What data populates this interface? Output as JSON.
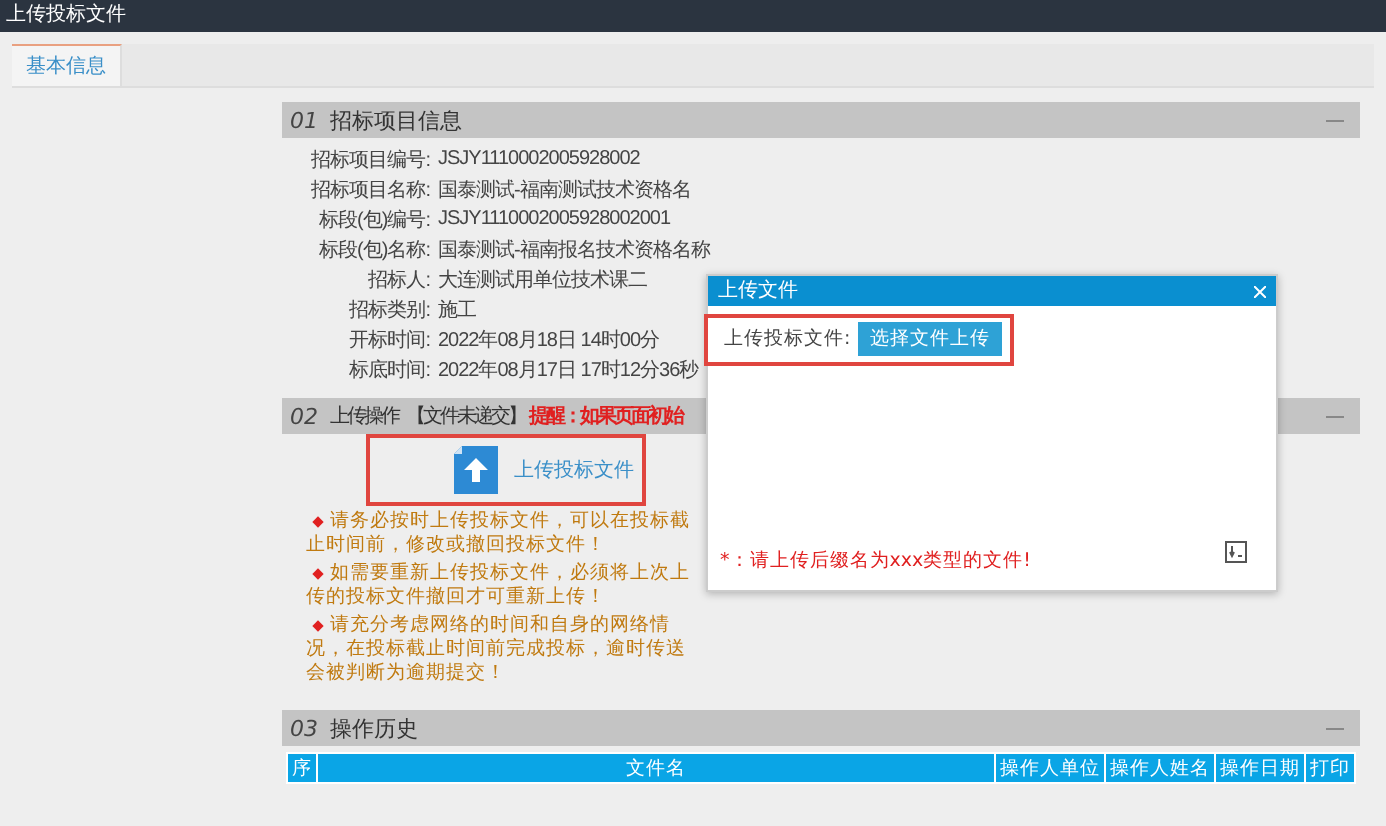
{
  "window": {
    "title": "上传投标文件"
  },
  "tabs": [
    {
      "label": "基本信息",
      "selected": true
    }
  ],
  "project_info": {
    "number": "01",
    "title": "招标项目信息",
    "fields": [
      {
        "label": "招标项目编号:",
        "value": "JSJY1110002005928002"
      },
      {
        "label": "招标项目名称:",
        "value": "国泰测试-福南测试技术资格名"
      },
      {
        "label": "标段(包)编号:",
        "value": "JSJY1110002005928002001"
      },
      {
        "label": "标段(包)名称:",
        "value": "国泰测试-福南报名技术资格名称"
      },
      {
        "label": "招标人:",
        "value": "大连测试用单位技术课二"
      },
      {
        "label": "招标类别:",
        "value": "施工"
      },
      {
        "label": "开标时间:",
        "value": "2022年08月18日 14时00分"
      },
      {
        "label": "标底时间:",
        "value": "2022年08月17日 17时12分36秒"
      }
    ]
  },
  "upload": {
    "number": "02",
    "title": "上传操作",
    "status": "【文件未递交】",
    "reminder": "提醒：如果页面初始",
    "link": "上传投标文件",
    "notes": [
      "请务必按时上传投标文件，可以在投标截止时间前，修改或撤回投标文件！",
      "如需要重新上传投标文件，必须将上次上传的投标文件撤回才可重新上传！",
      "请充分考虑网络的时间和自身的网络情况，在投标截止时间前完成投标，逾时传送会被判断为逾期提交！"
    ]
  },
  "history": {
    "number": "03",
    "title": "操作历史",
    "columns": [
      "序",
      "文件名",
      "操作人单位",
      "操作人姓名",
      "操作日期",
      "打印"
    ]
  },
  "dialog": {
    "title": "上传文件",
    "field_label": "上传投标文件:",
    "button": "选择文件上传",
    "warning": "*：请上传后缀名为xxx类型的文件!"
  }
}
